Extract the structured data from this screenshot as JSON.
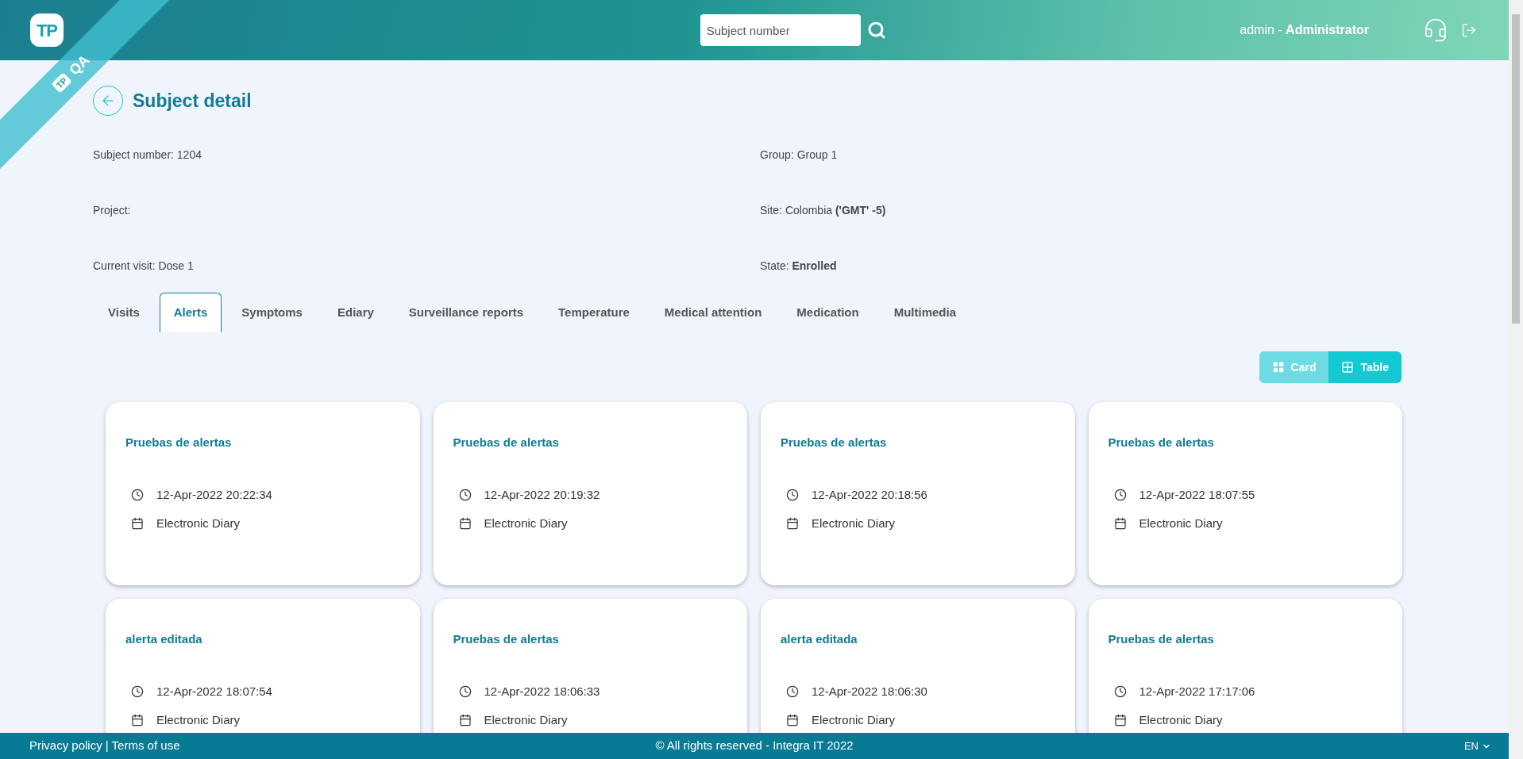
{
  "header": {
    "logo": "TP",
    "search": {
      "placeholder": "Subject number"
    },
    "user": "admin - **Administrator**"
  },
  "ribbon": {
    "logo": "TP",
    "label": "QA"
  },
  "page": {
    "title": "Subject detail"
  },
  "info": [
    "Subject number: 1204",
    "Group: Group 1",
    "Project:",
    "Site: Colombia **('GMT' -5)**",
    "Current visit: Dose 1",
    "State: **Enrolled**"
  ],
  "tabs": [
    {
      "label": "Visits",
      "selected": false
    },
    {
      "label": "Alerts",
      "selected": true
    },
    {
      "label": "Symptoms",
      "selected": false
    },
    {
      "label": "Ediary",
      "selected": false
    },
    {
      "label": "Surveillance reports",
      "selected": false
    },
    {
      "label": "Temperature",
      "selected": false
    },
    {
      "label": "Medical attention",
      "selected": false
    },
    {
      "label": "Medication",
      "selected": false
    },
    {
      "label": "Multimedia",
      "selected": false
    }
  ],
  "view_toggle": [
    {
      "kind": "card",
      "label": "Card",
      "selected": true
    },
    {
      "kind": "table",
      "label": "Table",
      "selected": false
    }
  ],
  "alerts": [
    {
      "title": "Pruebas de alertas",
      "time": "12-Apr-2022 20:22:34",
      "source": "Electronic Diary"
    },
    {
      "title": "Pruebas de alertas",
      "time": "12-Apr-2022 20:19:32",
      "source": "Electronic Diary"
    },
    {
      "title": "Pruebas de alertas",
      "time": "12-Apr-2022 20:18:56",
      "source": "Electronic Diary"
    },
    {
      "title": "Pruebas de alertas",
      "time": "12-Apr-2022 18:07:55",
      "source": "Electronic Diary"
    },
    {
      "title": "alerta editada",
      "time": "12-Apr-2022 18:07:54",
      "source": "Electronic Diary"
    },
    {
      "title": "Pruebas de alertas",
      "time": "12-Apr-2022 18:06:33",
      "source": "Electronic Diary"
    },
    {
      "title": "alerta editada",
      "time": "12-Apr-2022 18:06:30",
      "source": "Electronic Diary"
    },
    {
      "title": "Pruebas de alertas",
      "time": "12-Apr-2022 17:17:06",
      "source": "Electronic Diary"
    }
  ],
  "footer": {
    "links": [
      "Privacy policy",
      "Terms of use"
    ],
    "separator": "|",
    "copyright": "© All rights reserved - Integra IT 2022",
    "language": "EN"
  }
}
